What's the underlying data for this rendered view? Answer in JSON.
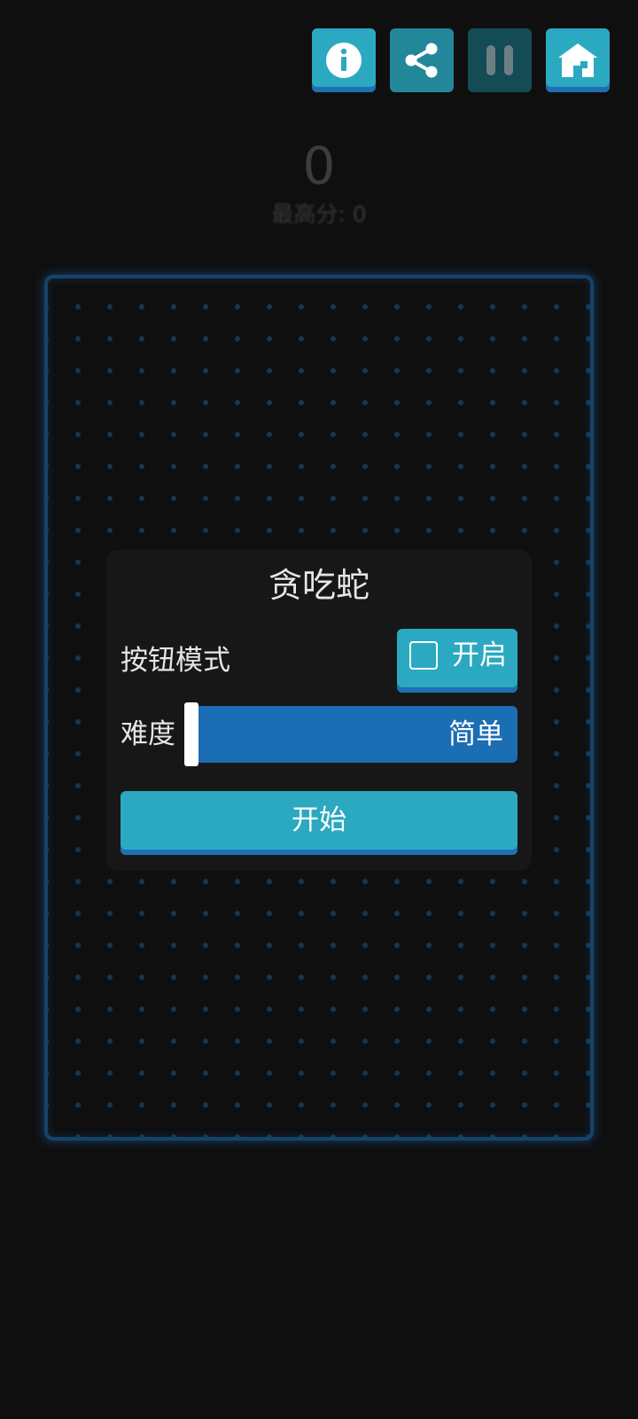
{
  "toolbar": {
    "buttons": [
      {
        "icon": "info-icon",
        "style": "primary"
      },
      {
        "icon": "share-icon",
        "style": "secondary"
      },
      {
        "icon": "pause-icon",
        "style": "disabled"
      },
      {
        "icon": "home-icon",
        "style": "primary"
      }
    ]
  },
  "score": {
    "current": "0",
    "best_label": "最高分: 0"
  },
  "dialog": {
    "title": "贪吃蛇",
    "button_mode_label": "按钮模式",
    "button_mode_toggle_label": "开启",
    "button_mode_enabled": false,
    "difficulty_label": "难度",
    "difficulty_value": "简单",
    "difficulty_level": 0,
    "start_label": "开始"
  },
  "colors": {
    "background": "#0f0f0f",
    "accent": "#2ba9c0",
    "accent_shadow": "#1f6fb6",
    "slider": "#1b6db4",
    "board_border": "#17426a"
  }
}
